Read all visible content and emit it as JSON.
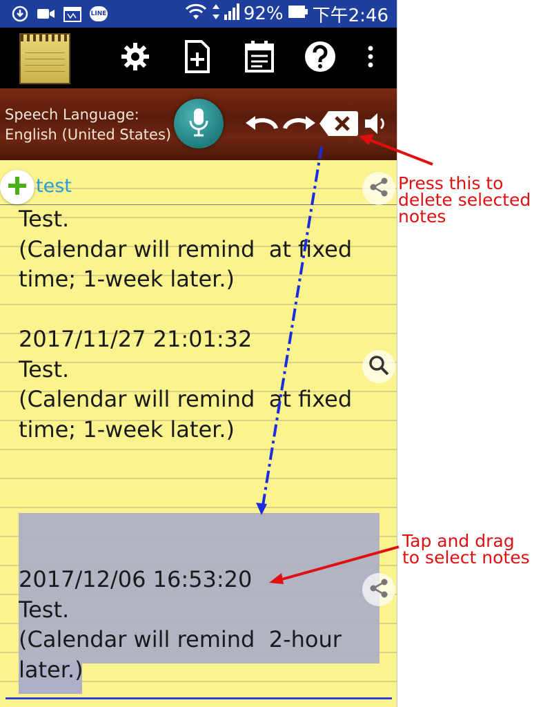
{
  "status_bar": {
    "battery": "92%",
    "time": "下午2:46",
    "line_badge": "LINE"
  },
  "toolbar": {
    "icons": [
      "settings-icon",
      "new-note-icon",
      "calendar-icon",
      "help-icon",
      "overflow-menu-icon"
    ]
  },
  "speech": {
    "label_line1": "Speech Language:",
    "label_line2": "English (United States)"
  },
  "note": {
    "title": "test",
    "body": "Test.\n(Calendar will remind  at fixed\ntime; 1-week later.)\n\n2017/11/27 21:01:32\nTest.\n(Calendar will remind  at fixed\ntime; 1-week later.)\n\n\n\n\n2017/12/06 16:53:20\nTest.\n(Calendar will remind  2-hour\nlater.)"
  },
  "annotations": {
    "delete_hint": "Press this to\ndelete selected\nnotes",
    "select_hint": "Tap and drag\nto select notes"
  },
  "colors": {
    "status_bar": "#1f3f9f",
    "toolbar": "#000000",
    "paper": "#fbf38d",
    "selection": "#aeb0c7",
    "annotation": "#e01010",
    "title": "#2a9ad8"
  }
}
